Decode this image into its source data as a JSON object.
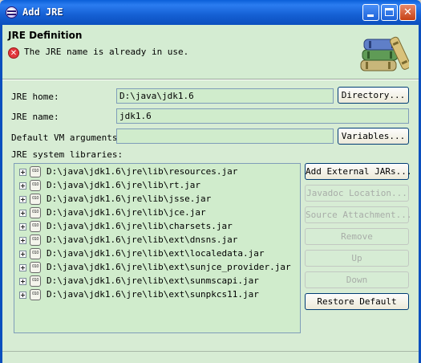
{
  "window": {
    "title": "Add JRE",
    "controls": [
      "minimize",
      "maximize",
      "close"
    ]
  },
  "header": {
    "title": "JRE Definition",
    "error_message": "The JRE name is already in use.",
    "error_icon": "error-icon",
    "banner_icon": "books-icon"
  },
  "form": {
    "jre_home": {
      "label": "JRE home:",
      "value": "D:\\java\\jdk1.6",
      "button": "Directory..."
    },
    "jre_name": {
      "label": "JRE name:",
      "value": "jdk1.6"
    },
    "vm_args": {
      "label": "Default VM arguments:",
      "value": "",
      "button": "Variables..."
    },
    "libraries_label": "JRE system libraries:"
  },
  "libraries": [
    "D:\\java\\jdk1.6\\jre\\lib\\resources.jar",
    "D:\\java\\jdk1.6\\jre\\lib\\rt.jar",
    "D:\\java\\jdk1.6\\jre\\lib\\jsse.jar",
    "D:\\java\\jdk1.6\\jre\\lib\\jce.jar",
    "D:\\java\\jdk1.6\\jre\\lib\\charsets.jar",
    "D:\\java\\jdk1.6\\jre\\lib\\ext\\dnsns.jar",
    "D:\\java\\jdk1.6\\jre\\lib\\ext\\localedata.jar",
    "D:\\java\\jdk1.6\\jre\\lib\\ext\\sunjce_provider.jar",
    "D:\\java\\jdk1.6\\jre\\lib\\ext\\sunmscapi.jar",
    "D:\\java\\jdk1.6\\jre\\lib\\ext\\sunpkcs11.jar"
  ],
  "side_buttons": {
    "add_external_jars": {
      "label": "Add External JARs...",
      "enabled": true
    },
    "javadoc_location": {
      "label": "Javadoc Location...",
      "enabled": false
    },
    "source_attachment": {
      "label": "Source Attachment...",
      "enabled": false
    },
    "remove": {
      "label": "Remove",
      "enabled": false
    },
    "up": {
      "label": "Up",
      "enabled": false
    },
    "down": {
      "label": "Down",
      "enabled": false
    },
    "restore_default": {
      "label": "Restore Default",
      "enabled": true
    }
  },
  "colors": {
    "titlebar": "#0b4fbe",
    "dialog_bg": "#d7ecd4",
    "field_bg": "#d0eccc",
    "error_red": "#e2373c"
  }
}
